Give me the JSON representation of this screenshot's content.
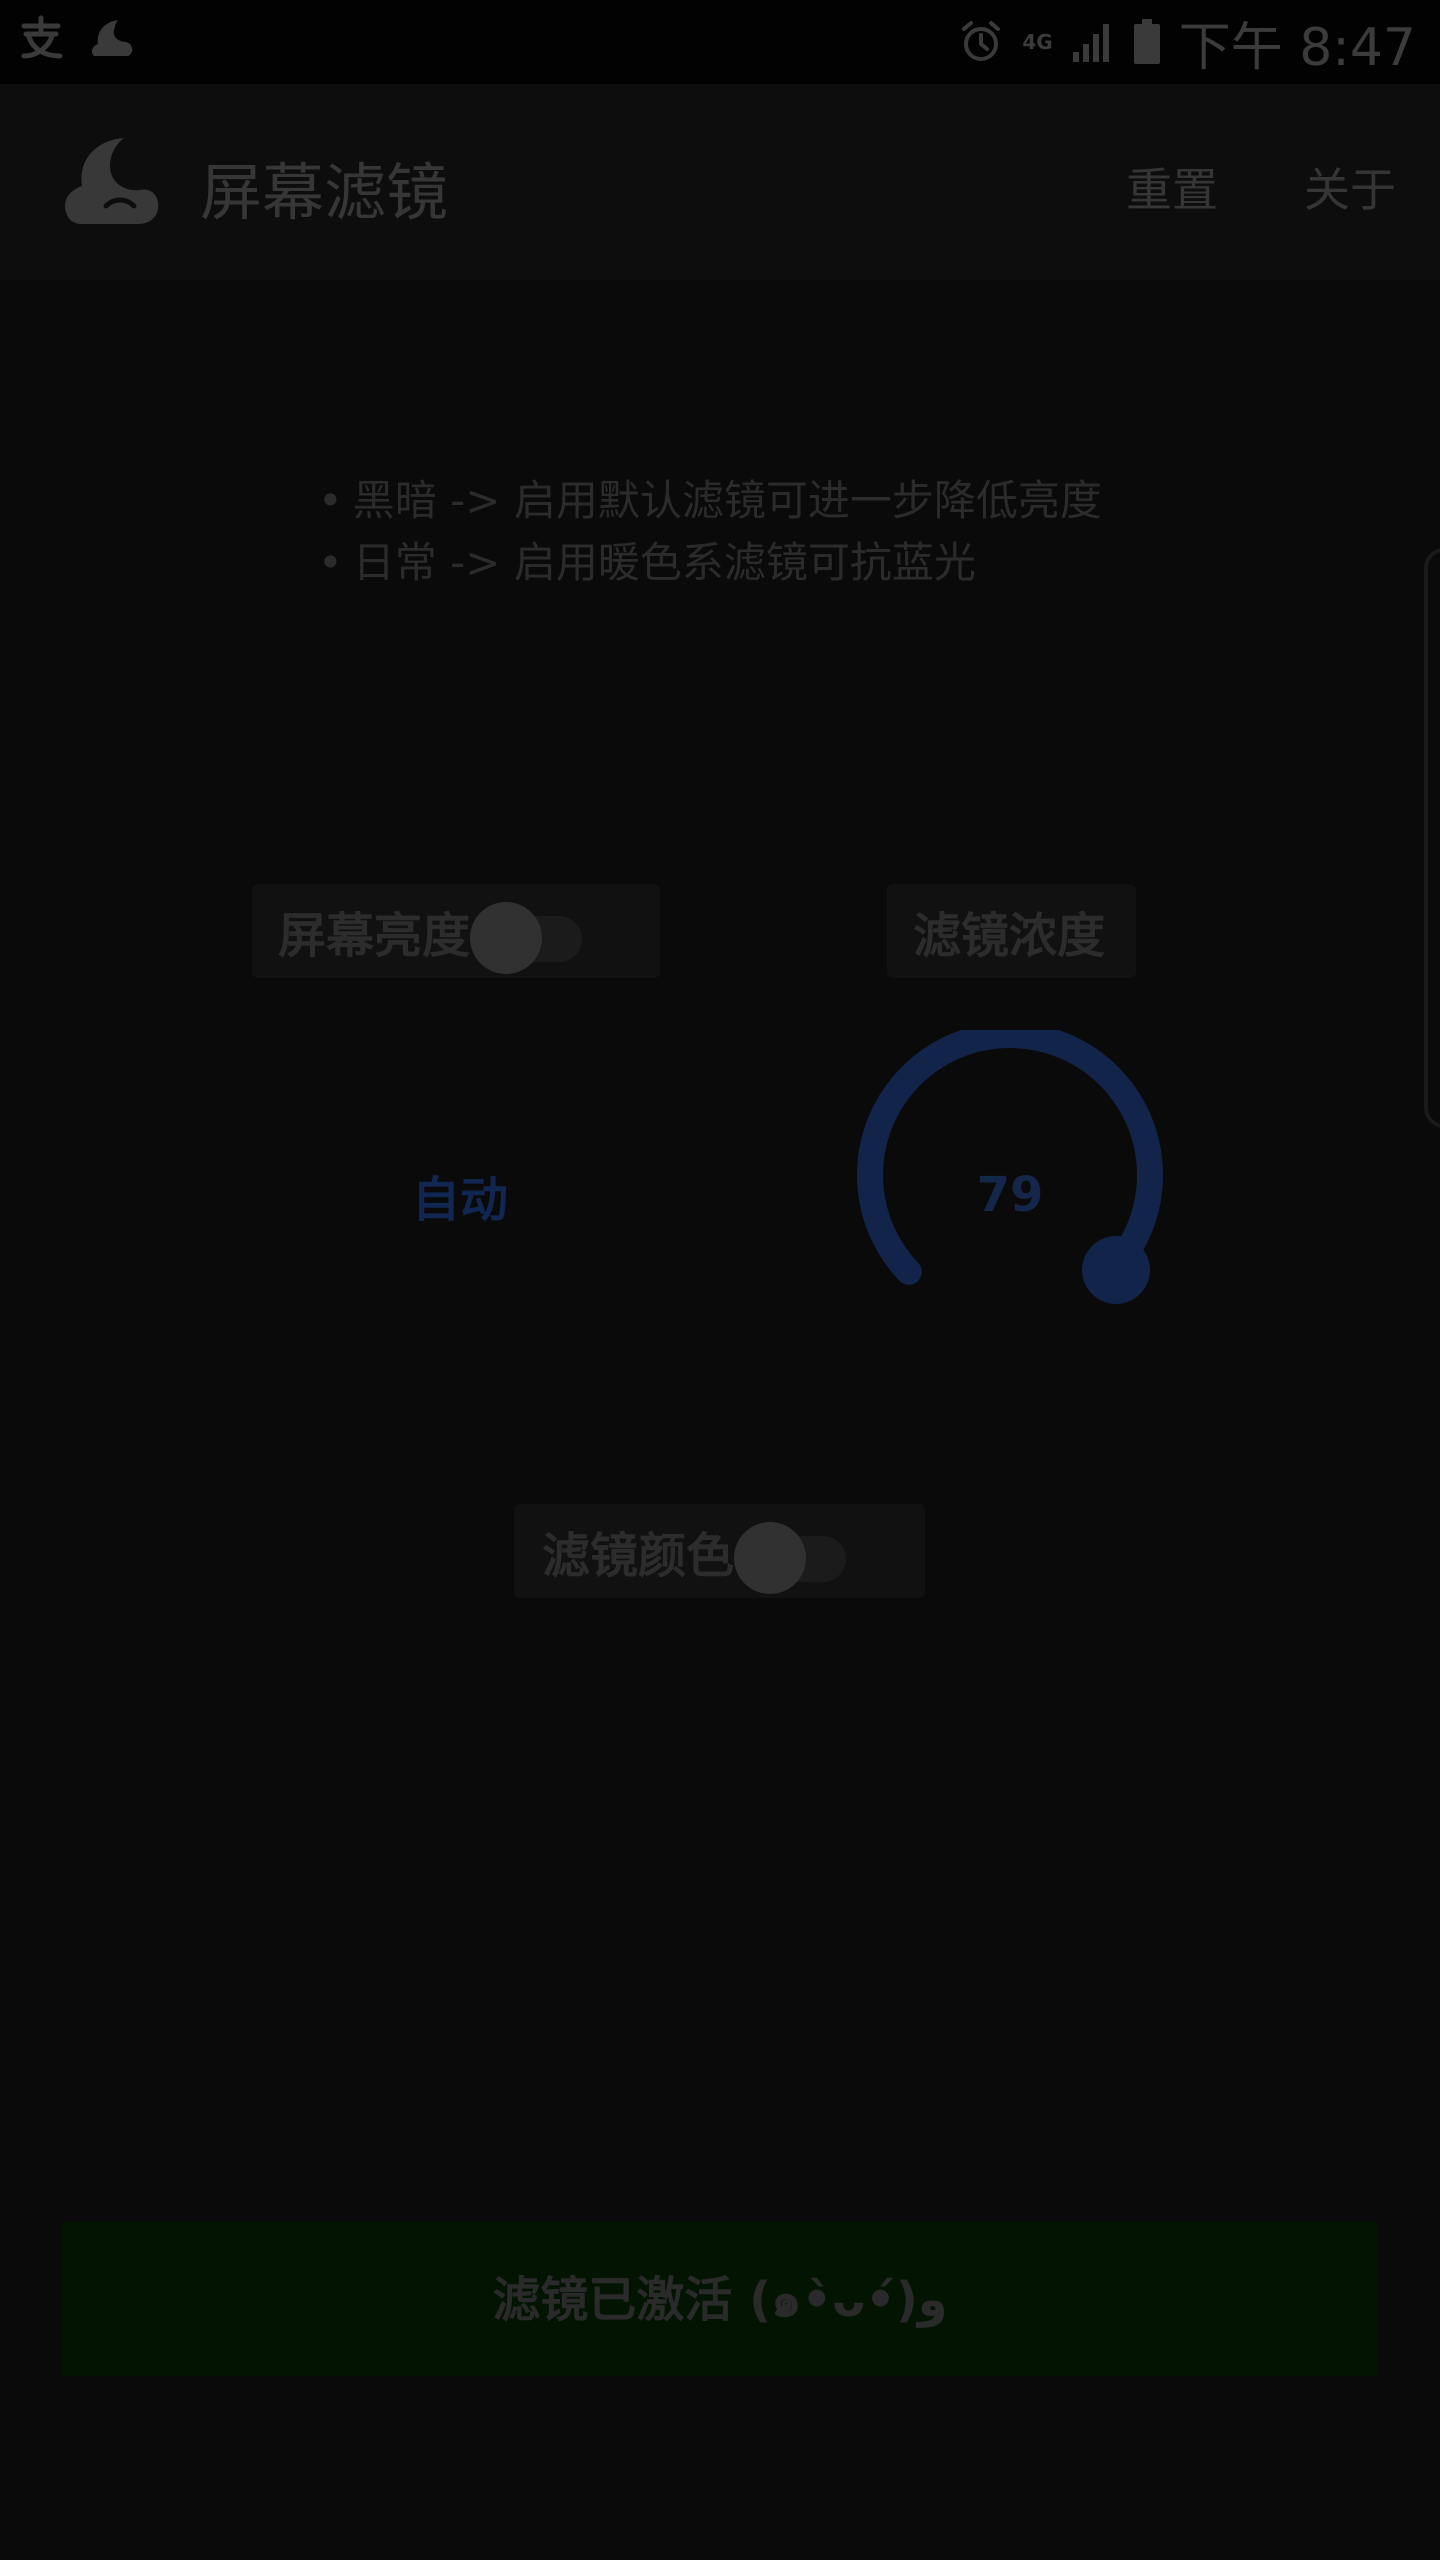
{
  "status_bar": {
    "time": "下午 8:47",
    "network": "4G",
    "icons": [
      "alipay-icon",
      "moon-app-icon",
      "alarm-icon",
      "signal-icon",
      "battery-icon"
    ]
  },
  "app_bar": {
    "title": "屏幕滤镜",
    "reset_label": "重置",
    "about_label": "关于"
  },
  "tips": {
    "bullet": "•",
    "line1": "黑暗 -> 启用默认滤镜可进一步降低亮度",
    "line2": "日常 -> 启用暖色系滤镜可抗蓝光"
  },
  "brightness": {
    "label": "屏幕亮度",
    "toggle_on": false,
    "value_label": "自动"
  },
  "density": {
    "label": "滤镜浓度",
    "value": "79"
  },
  "filter_color": {
    "label": "滤镜颜色",
    "toggle_on": false
  },
  "activate_button": {
    "label": "滤镜已激活 (๑•̀ᴗ•́)و"
  },
  "colors": {
    "background": "#0a0a0a",
    "dial_accent": "#12244a",
    "activate_bg": "#031403"
  }
}
